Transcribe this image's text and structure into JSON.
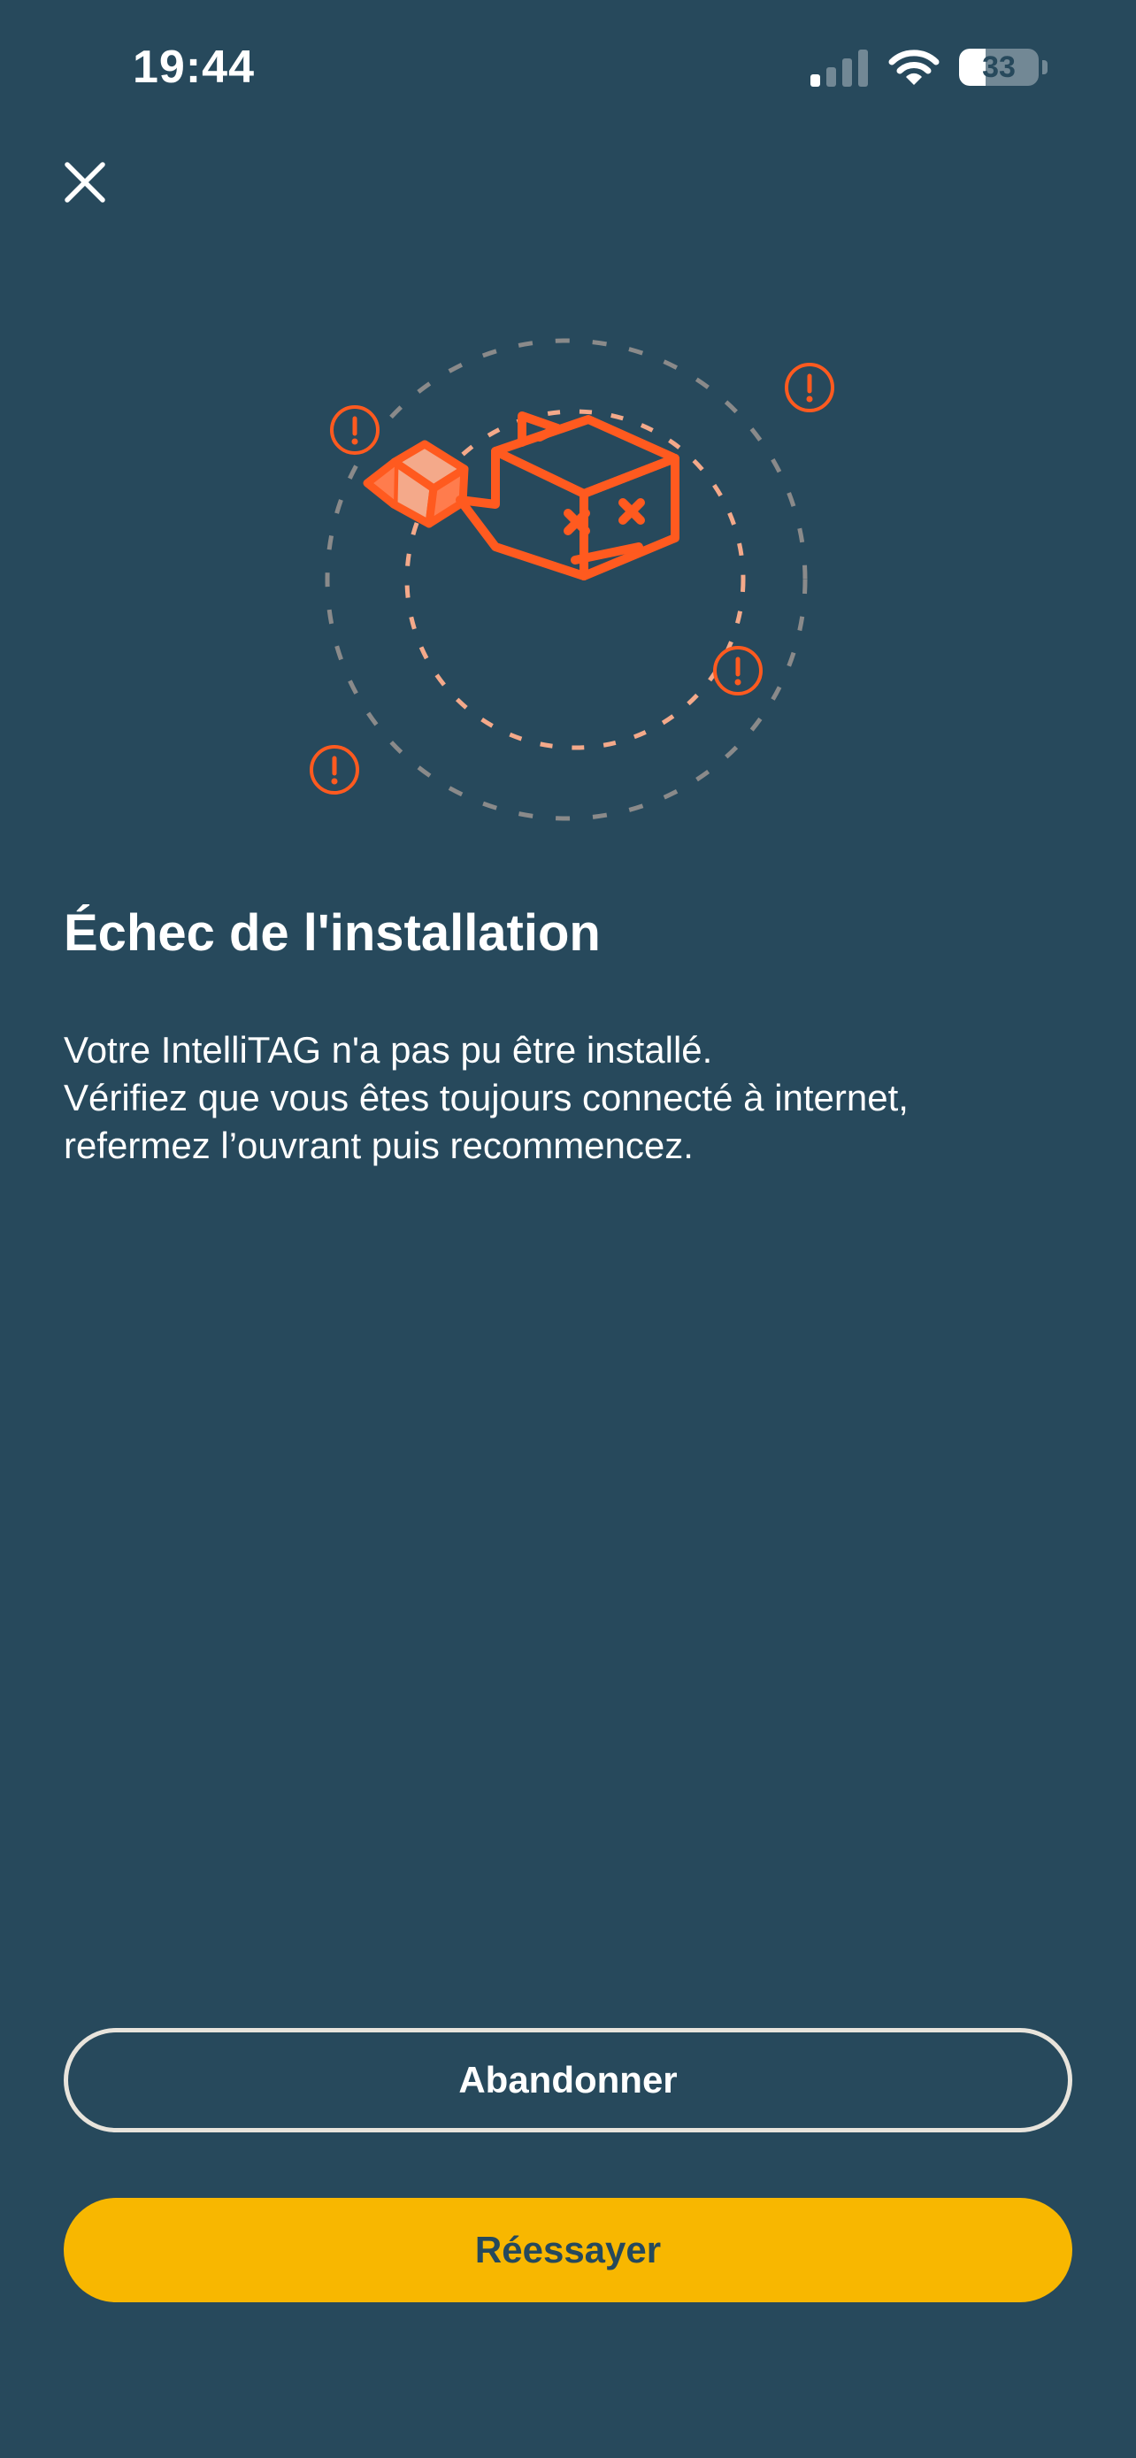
{
  "status_bar": {
    "time": "19:44",
    "battery": "33",
    "battery_level": 0.33,
    "icons": [
      "cellular-signal-icon",
      "wifi-icon",
      "battery-icon"
    ]
  },
  "header": {
    "close_icon": "close-icon"
  },
  "illustration": {
    "icon": "broken-box-error-illustration",
    "accent_color": "#ff5a1f"
  },
  "content": {
    "title": "Échec de l'installation",
    "message_lines": [
      "Votre IntelliTAG n'a pas pu être installé.",
      "Vérifiez que vous êtes toujours connecté à internet,",
      "refermez l’ouvrant puis recommencez."
    ]
  },
  "actions": {
    "abandon_label": "Abandonner",
    "retry_label": "Réessayer"
  },
  "colors": {
    "background": "#27495c",
    "primary_button": "#f8b700",
    "accent": "#ff5a1f"
  }
}
